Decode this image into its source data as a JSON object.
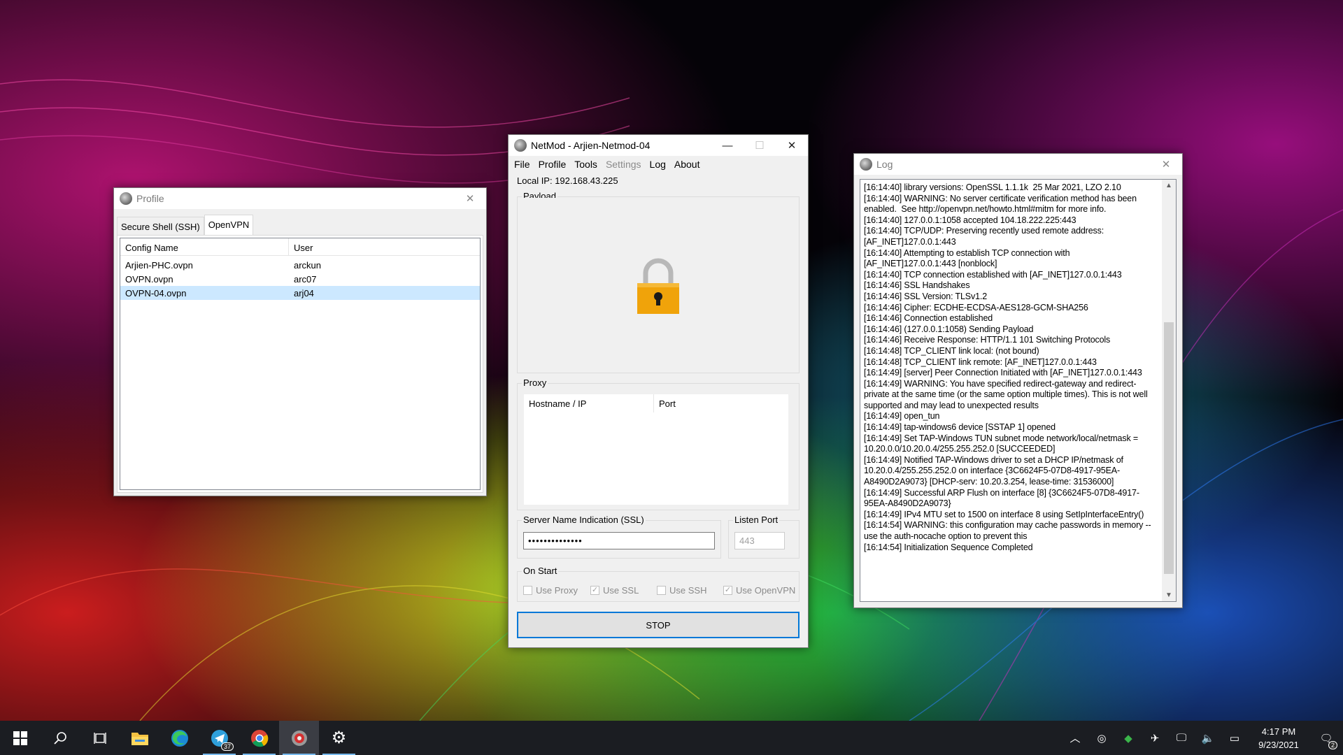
{
  "profile_window": {
    "title": "Profile",
    "tabs": [
      "Secure Shell (SSH)",
      "OpenVPN"
    ],
    "active_tab": "OpenVPN",
    "columns": [
      "Config Name",
      "User"
    ],
    "rows": [
      {
        "config": "Arjien-PHC.ovpn",
        "user": "arckun",
        "selected": false
      },
      {
        "config": "OVPN.ovpn",
        "user": "arc07",
        "selected": false
      },
      {
        "config": "OVPN-04.ovpn",
        "user": "arj04",
        "selected": true
      }
    ]
  },
  "netmod_window": {
    "title": "NetMod - Arjien-Netmod-04",
    "menu": [
      {
        "label": "File",
        "enabled": true
      },
      {
        "label": "Profile",
        "enabled": true
      },
      {
        "label": "Tools",
        "enabled": true
      },
      {
        "label": "Settings",
        "enabled": false
      },
      {
        "label": "Log",
        "enabled": true
      },
      {
        "label": "About",
        "enabled": true
      }
    ],
    "local_ip": "Local IP: 192.168.43.225",
    "payload_label": "Payload",
    "proxy_label": "Proxy",
    "proxy_columns": [
      "Hostname / IP",
      "Port"
    ],
    "sni_label": "Server Name Indication (SSL)",
    "sni_value": "••••••••••••••",
    "listen_port_label": "Listen Port",
    "listen_port_value": "443",
    "on_start_label": "On Start",
    "checkboxes": [
      {
        "label": "Use Proxy",
        "checked": false
      },
      {
        "label": "Use SSL",
        "checked": true
      },
      {
        "label": "Use SSH",
        "checked": false
      },
      {
        "label": "Use OpenVPN",
        "checked": true
      }
    ],
    "stop_button": "STOP",
    "lock_color": "#f0a30a"
  },
  "log_window": {
    "title": "Log",
    "lines": [
      "[16:14:40] library versions: OpenSSL 1.1.1k  25 Mar 2021, LZO 2.10",
      "[16:14:40] WARNING: No server certificate verification method has been enabled.  See http://openvpn.net/howto.html#mitm for more info.",
      "[16:14:40] 127.0.0.1:1058 accepted 104.18.222.225:443",
      "[16:14:40] TCP/UDP: Preserving recently used remote address: [AF_INET]127.0.0.1:443",
      "[16:14:40] Attempting to establish TCP connection with [AF_INET]127.0.0.1:443 [nonblock]",
      "[16:14:40] TCP connection established with [AF_INET]127.0.0.1:443",
      "[16:14:46] SSL Handshakes",
      "[16:14:46] SSL Version: TLSv1.2",
      "[16:14:46] Cipher: ECDHE-ECDSA-AES128-GCM-SHA256",
      "[16:14:46] Connection established",
      "[16:14:46] (127.0.0.1:1058) Sending Payload",
      "[16:14:46] Receive Response: HTTP/1.1 101 Switching Protocols",
      "[16:14:48] TCP_CLIENT link local: (not bound)",
      "[16:14:48] TCP_CLIENT link remote: [AF_INET]127.0.0.1:443",
      "[16:14:49] [server] Peer Connection Initiated with [AF_INET]127.0.0.1:443",
      "[16:14:49] WARNING: You have specified redirect-gateway and redirect-private at the same time (or the same option multiple times). This is not well supported and may lead to unexpected results",
      "[16:14:49] open_tun",
      "[16:14:49] tap-windows6 device [SSTAP 1] opened",
      "[16:14:49] Set TAP-Windows TUN subnet mode network/local/netmask = 10.20.0.0/10.20.0.4/255.255.252.0 [SUCCEEDED]",
      "[16:14:49] Notified TAP-Windows driver to set a DHCP IP/netmask of 10.20.0.4/255.255.252.0 on interface {3C6624F5-07D8-4917-95EA-A8490D2A9073} [DHCP-serv: 10.20.3.254, lease-time: 31536000]",
      "[16:14:49] Successful ARP Flush on interface [8] {3C6624F5-07D8-4917-95EA-A8490D2A9073}",
      "[16:14:49] IPv4 MTU set to 1500 on interface 8 using SetIpInterfaceEntry()",
      "[16:14:54] WARNING: this configuration may cache passwords in memory -- use the auth-nocache option to prevent this",
      "[16:14:54] Initialization Sequence Completed"
    ]
  },
  "taskbar": {
    "apps": [
      {
        "icon": "start-icon",
        "active": false,
        "open": false
      },
      {
        "icon": "search-icon",
        "active": false,
        "open": false
      },
      {
        "icon": "task-view-icon",
        "active": false,
        "open": false
      },
      {
        "icon": "file-explorer-icon",
        "active": false,
        "open": false
      },
      {
        "icon": "edge-icon",
        "active": false,
        "open": false
      },
      {
        "icon": "telegram-icon",
        "active": false,
        "open": true,
        "badge": "37"
      },
      {
        "icon": "chrome-icon",
        "active": false,
        "open": true
      },
      {
        "icon": "netmod-icon",
        "active": true,
        "open": true
      },
      {
        "icon": "settings-icon",
        "active": false,
        "open": true
      }
    ],
    "clock_time": "4:17 PM",
    "clock_date": "9/23/2021",
    "notification_count": "2"
  }
}
